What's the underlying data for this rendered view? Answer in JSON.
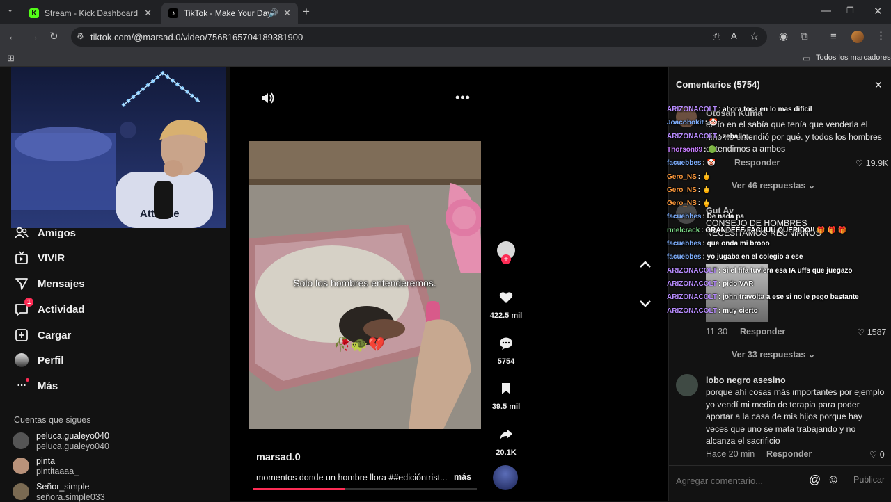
{
  "browser": {
    "tabs": [
      {
        "title": "Stream - Kick Dashboard",
        "favicon": "K"
      },
      {
        "title": "TikTok - Make Your Day",
        "favicon": "♪"
      }
    ],
    "url": "tiktok.com/@marsad.0/video/7568165704189381900",
    "bookmarks_label": "Todos los marcadores"
  },
  "sidebar": {
    "nav": [
      {
        "label": "Amigos",
        "icon": "friends-icon"
      },
      {
        "label": "VIVIR",
        "icon": "live-icon"
      },
      {
        "label": "Mensajes",
        "icon": "messages-icon"
      },
      {
        "label": "Actividad",
        "icon": "activity-icon",
        "badge": "1"
      },
      {
        "label": "Cargar",
        "icon": "upload-icon"
      },
      {
        "label": "Perfil",
        "icon": "profile-icon"
      },
      {
        "label": "Más",
        "icon": "more-icon"
      }
    ],
    "following_title": "Cuentas que sigues",
    "following": [
      {
        "name": "peluca.gualeyo040",
        "handle": "peluca.gualeyo040"
      },
      {
        "name": "pinta",
        "handle": "pintitaaaa_"
      },
      {
        "name": "Señor_simple",
        "handle": "señora.simple033"
      }
    ]
  },
  "webcam": {
    "shirt_text": "Attitude"
  },
  "video": {
    "caption_overlay": "Solo los hombres entenderemos.",
    "emoji_overlay": "🥀🐢💔",
    "author": "marsad.0",
    "description": "momentos donde un hombre llora ##edicióntrist...",
    "more_label": "más",
    "progress": 0.41,
    "likes": "422.5 mil",
    "comments": "5754",
    "saves": "39.5 mil",
    "shares": "20.1K"
  },
  "comments_panel": {
    "title": "Comentarios (5754)",
    "items": [
      {
        "user": "Otosan Kuma",
        "text": "el tío en el sabía que tenía que venderla el niño no entendió por qué. y todos los hombres entendimos a ambos",
        "reply": "Responder",
        "likes": "19.9K",
        "view_replies": "Ver 46 respuestas"
      },
      {
        "user": "Gut Av",
        "text": "CONSEJO DE HOMBRES NECESITAMOS REUNIRNOS",
        "date": "11-30",
        "reply": "Responder",
        "likes": "1587",
        "view_replies": "Ver 33 respuestas"
      },
      {
        "user": "lobo negro asesino",
        "text": "porque ahí cosas más importantes por ejemplo yo vendí mi medio de terapia para poder aportar a la casa de mis hijos porque hay veces que uno se mata trabajando y no alcanza el sacrificio",
        "date": "Hace 20 min",
        "reply": "Responder",
        "likes": "0"
      }
    ],
    "input_placeholder": "Agregar comentario...",
    "publish_label": "Publicar"
  },
  "stream_chat": [
    {
      "user": "ARIZONACOLT",
      "color": "#b88cff",
      "msg": ": ahora toca en lo mas difícil"
    },
    {
      "user": "Joacobokit",
      "color": "#7fb0ff",
      "msg": ": 🤡"
    },
    {
      "user": "ARIZONACOLT",
      "color": "#b88cff",
      "msg": ": zeballo"
    },
    {
      "user": "Thorson89",
      "color": "#c87dff",
      "msg": ": 🟢"
    },
    {
      "user": "facuebbes",
      "color": "#7fb0ff",
      "msg": ": 🤡"
    },
    {
      "user": "Gero_NS",
      "color": "#ff9a3c",
      "msg": ": 🖕"
    },
    {
      "user": "Gero_NS",
      "color": "#ff9a3c",
      "msg": ": 🖕"
    },
    {
      "user": "Gero_NS",
      "color": "#ff9a3c",
      "msg": ": 🖕"
    },
    {
      "user": "facuebbes",
      "color": "#7fb0ff",
      "msg": ": De nada pa"
    },
    {
      "user": "rmelcrack",
      "color": "#7fe08a",
      "msg": ": GRANDEEE FACUUU QUERIDO!! 🎁 🎁 🎁"
    },
    {
      "user": "facuebbes",
      "color": "#7fb0ff",
      "msg": ": que onda mi brooo"
    },
    {
      "user": "facuebbes",
      "color": "#7fb0ff",
      "msg": ": yo jugaba en el colegio a ese"
    },
    {
      "user": "ARIZONACOLT",
      "color": "#b88cff",
      "msg": ": si el fifa tuviera esa IA uffs que juegazo"
    },
    {
      "user": "ARIZONACOLT",
      "color": "#b88cff",
      "msg": ": pido VAR"
    },
    {
      "user": "ARIZONACOLT",
      "color": "#b88cff",
      "msg": ": john travolta a ese si no le pego bastante"
    },
    {
      "user": "ARIZONACOLT",
      "color": "#b88cff",
      "msg": ": muy cierto"
    }
  ],
  "colors": {
    "accent": "#fe2c55",
    "kick_green": "#53fc18"
  }
}
